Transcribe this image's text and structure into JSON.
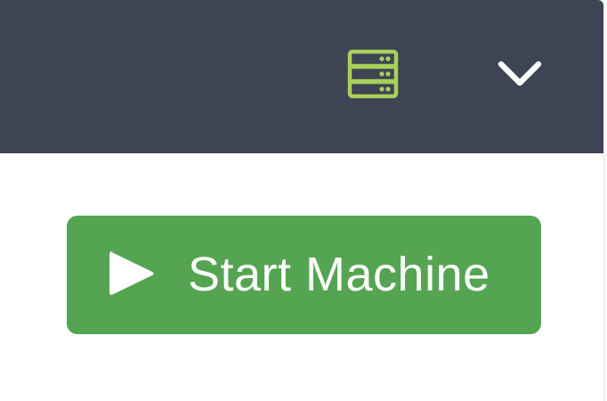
{
  "header": {
    "server_icon": "server-stack-icon",
    "menu_icon": "chevron-down-icon"
  },
  "start_button": {
    "label": "Start Machine",
    "icon": "play-icon"
  },
  "colors": {
    "header_background": "#3d4453",
    "server_icon": "#a9d05a",
    "chevron": "#ffffff",
    "button_background": "#55a452",
    "button_text": "#ffffff"
  }
}
